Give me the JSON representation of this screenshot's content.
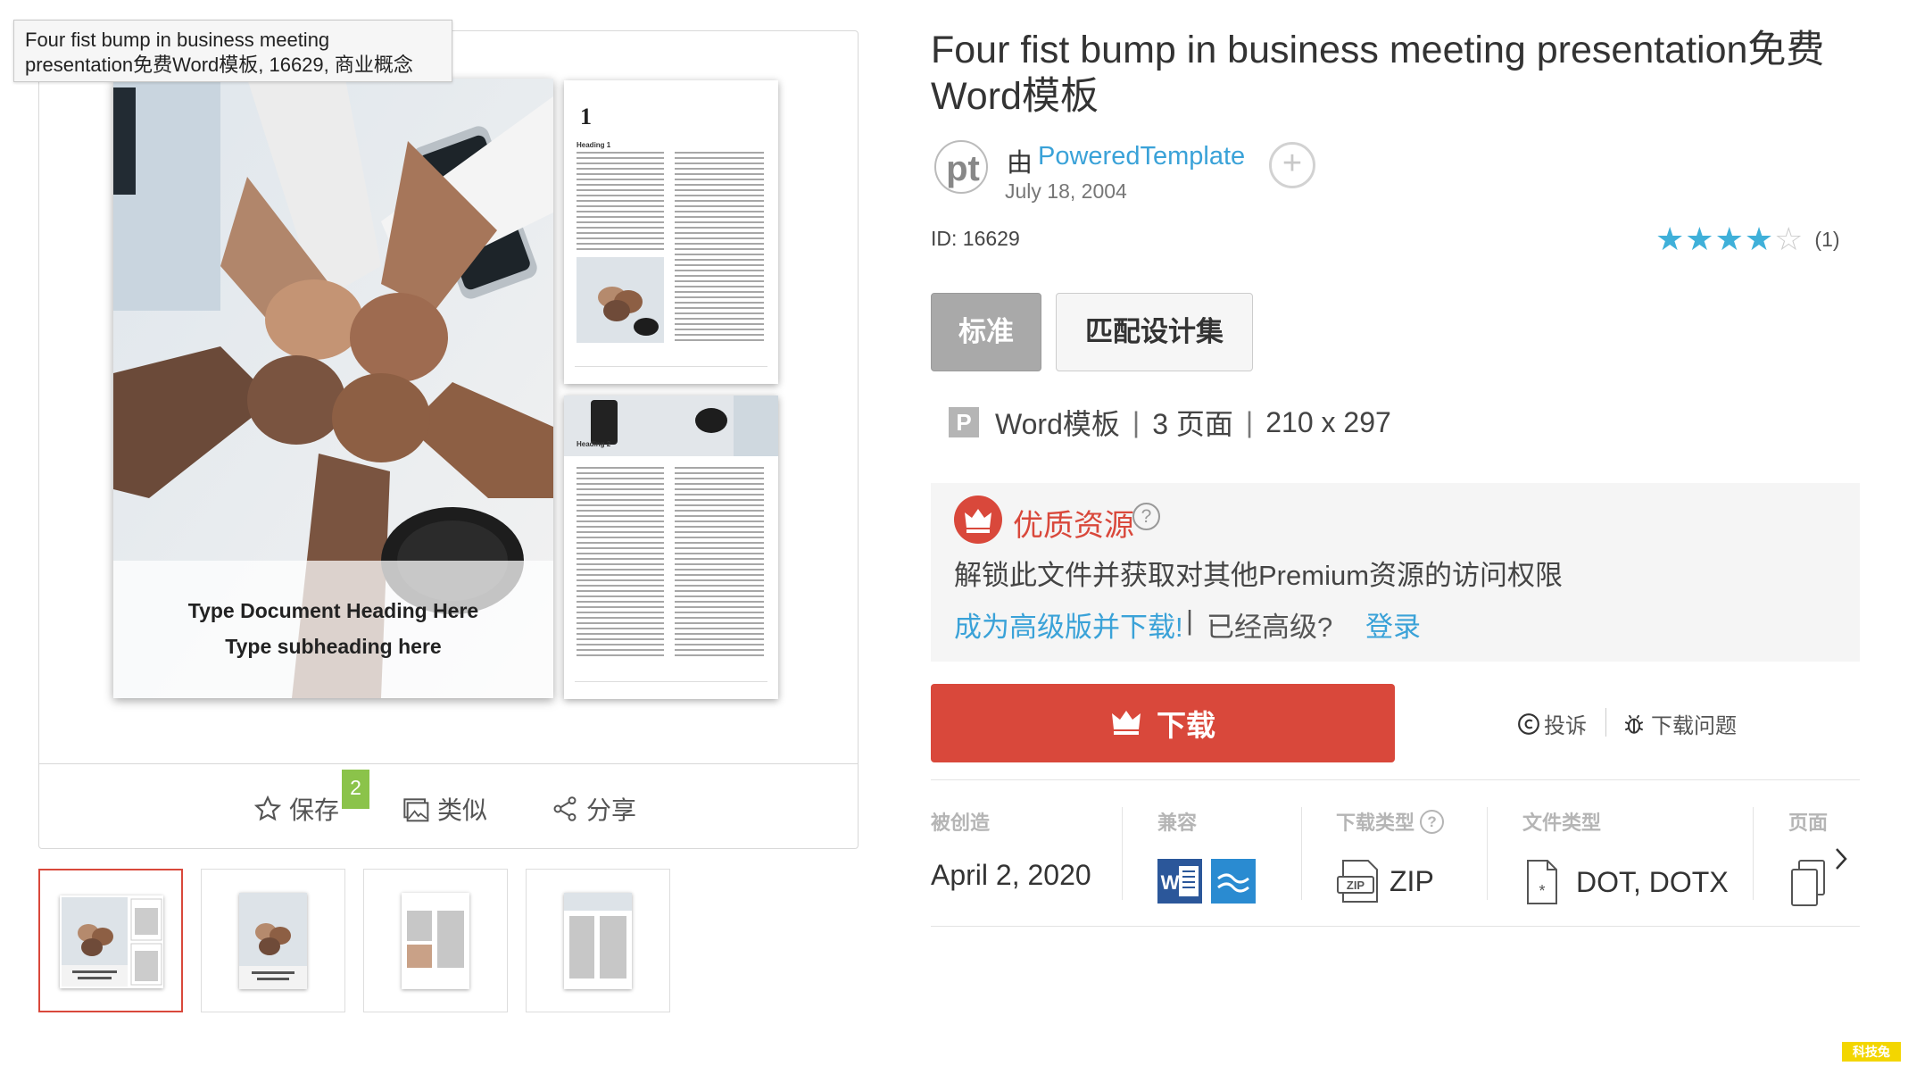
{
  "tooltip": {
    "line1": "Four fist bump in business meeting",
    "line2": "presentation免费Word模板, 16629, 商业概念"
  },
  "cover": {
    "heading": "Type Document Heading Here",
    "subheading": "Type subheading here"
  },
  "preview_page1": {
    "number": "1",
    "heading": "Heading 1"
  },
  "preview_page2": {
    "heading": "Heading 2"
  },
  "actions": {
    "save_label": "保存",
    "save_count": "2",
    "similar_label": "类似",
    "share_label": "分享"
  },
  "thumbnails": [
    {
      "name": "thumb-1",
      "active": true
    },
    {
      "name": "thumb-2",
      "active": false
    },
    {
      "name": "thumb-3",
      "active": false
    },
    {
      "name": "thumb-4",
      "active": false
    }
  ],
  "template": {
    "title": "Four fist bump in business meeting presentation免费Word模板",
    "by_label": "由",
    "author": "PoweredTemplate",
    "author_date": "July 18, 2004",
    "follow_symbol": "+",
    "id_label": "ID: 16629",
    "rating_value": 4,
    "rating_max": 5,
    "rating_count": "(1)"
  },
  "tabs": {
    "standard": "标准",
    "match_set": "匹配设计集"
  },
  "meta": {
    "p_badge": "P",
    "format": "Word模板",
    "pages": "3 页面",
    "size": "210 x 297",
    "separator": "|"
  },
  "premium": {
    "title": "优质资源",
    "help": "?",
    "text": "解锁此文件并获取对其他Premium资源的访问权限",
    "go_premium": "成为高级版并下载!",
    "sep": "|",
    "already": "已经高级?",
    "login": "登录"
  },
  "download": {
    "label": "下载",
    "report": "投诉",
    "issue": "下载问题"
  },
  "info": {
    "created_label": "被创造",
    "created_value": "April 2, 2020",
    "compat_label": "兼容",
    "download_type_label": "下载类型",
    "download_type_value": "ZIP",
    "file_type_label": "文件类型",
    "file_type_value": "DOT, DOTX",
    "pages_label": "页面"
  },
  "watermark": "科技兔",
  "colors": {
    "accent_red": "#d9483b",
    "link_blue": "#3aa2d8",
    "star_blue": "#3fb0d9",
    "badge_green": "#8bc34a"
  }
}
